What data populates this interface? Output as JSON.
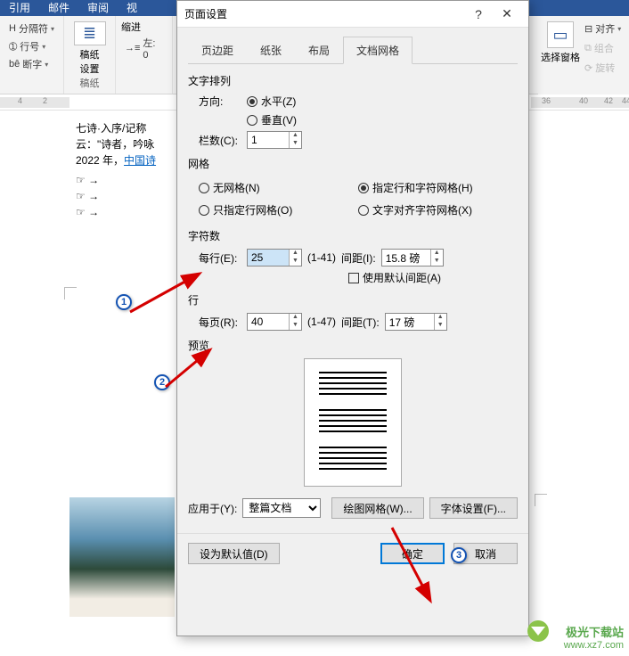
{
  "ribbon_tabs": {
    "t1": "引用",
    "t2": "邮件",
    "t3": "审阅",
    "t4": "视"
  },
  "ribbon": {
    "breaks": "分隔符",
    "lineno": "行号",
    "hyphen": "断字",
    "manuscript": "稿纸",
    "manuscript_sub": "设置",
    "manuscript_grp": "稿纸",
    "indent": "缩进",
    "left": "左: 0",
    "selpane": "选择窗格",
    "align": "对齐",
    "group": "组合",
    "rotate": "旋转"
  },
  "doc": {
    "line1": "七诗·入序/记称",
    "line2_a": "云：\"诗者，吟咏",
    "line3_a": "2022 年，",
    "line3_link": "中国诗"
  },
  "dialog": {
    "title": "页面设置",
    "tabs": {
      "margin": "页边距",
      "paper": "纸张",
      "layout": "布局",
      "grid": "文档网格"
    },
    "text_arrange": "文字排列",
    "direction": "方向:",
    "horizontal": "水平(Z)",
    "vertical": "垂直(V)",
    "columns_lbl": "栏数(C):",
    "columns_val": "1",
    "grid_h": "网格",
    "no_grid": "无网格(N)",
    "line_char_grid": "指定行和字符网格(H)",
    "line_grid": "只指定行网格(O)",
    "align_grid": "文字对齐字符网格(X)",
    "charcount_h": "字符数",
    "per_line_lbl": "每行(E):",
    "per_line_val": "25",
    "per_line_range": "(1-41)",
    "spacing1_lbl": "间距(I):",
    "spacing1_val": "15.8 磅",
    "use_default": "使用默认间距(A)",
    "lines_h": "行",
    "per_page_lbl": "每页(R):",
    "per_page_val": "40",
    "per_page_range": "(1-47)",
    "spacing2_lbl": "间距(T):",
    "spacing2_val": "17 磅",
    "preview_h": "预览",
    "apply_lbl": "应用于(Y):",
    "apply_val": "整篇文档",
    "draw_grid": "绘图网格(W)...",
    "font_settings": "字体设置(F)...",
    "set_default": "设为默认值(D)",
    "ok": "确定",
    "cancel": "取消"
  },
  "watermark": {
    "l1": "极光下载站",
    "l2": "www.xz7.com"
  }
}
